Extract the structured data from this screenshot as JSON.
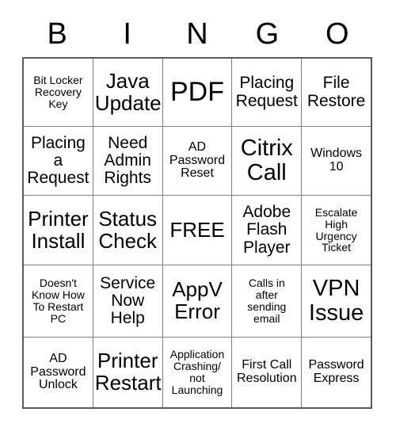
{
  "card": {
    "header_letters": [
      "B",
      "I",
      "N",
      "G",
      "O"
    ],
    "free_space_label": "FREE",
    "rows": [
      [
        {
          "label": "Bit Locker\nRecovery\nKey",
          "size": "xs"
        },
        {
          "label": "Java\nUpdate",
          "size": "lg"
        },
        {
          "label": "PDF",
          "size": "xxl"
        },
        {
          "label": "Placing\nRequest",
          "size": "md"
        },
        {
          "label": "File\nRestore",
          "size": "md"
        }
      ],
      [
        {
          "label": "Placing\na\nRequest",
          "size": "md"
        },
        {
          "label": "Need\nAdmin\nRights",
          "size": "md"
        },
        {
          "label": "AD\nPassword\nReset",
          "size": "sm"
        },
        {
          "label": "Citrix\nCall",
          "size": "xl"
        },
        {
          "label": "Windows\n10",
          "size": "sm"
        }
      ],
      [
        {
          "label": "Printer\nInstall",
          "size": "lg"
        },
        {
          "label": "Status\nCheck",
          "size": "lg"
        },
        {
          "label": "FREE",
          "size": "lg"
        },
        {
          "label": "Adobe\nFlash\nPlayer",
          "size": "md"
        },
        {
          "label": "Escalate\nHigh\nUrgency\nTicket",
          "size": "xs"
        }
      ],
      [
        {
          "label": "Doesn't\nKnow How\nTo Restart\nPC",
          "size": "xs"
        },
        {
          "label": "Service\nNow\nHelp",
          "size": "md"
        },
        {
          "label": "AppV\nError",
          "size": "lg"
        },
        {
          "label": "Calls in\nafter\nsending\nemail",
          "size": "xs"
        },
        {
          "label": "VPN\nIssue",
          "size": "xl"
        }
      ],
      [
        {
          "label": "AD\nPassword\nUnlock",
          "size": "sm"
        },
        {
          "label": "Printer\nRestart",
          "size": "lg"
        },
        {
          "label": "Application\nCrashing/\nnot\nLaunching",
          "size": "xs"
        },
        {
          "label": "First Call\nResolution",
          "size": "sm"
        },
        {
          "label": "Password\nExpress",
          "size": "sm"
        }
      ]
    ]
  },
  "colors": {
    "background": "#ffffff",
    "text": "#000000",
    "grid_outer_border": "#595959",
    "grid_inner_border": "#7f7f7f"
  }
}
